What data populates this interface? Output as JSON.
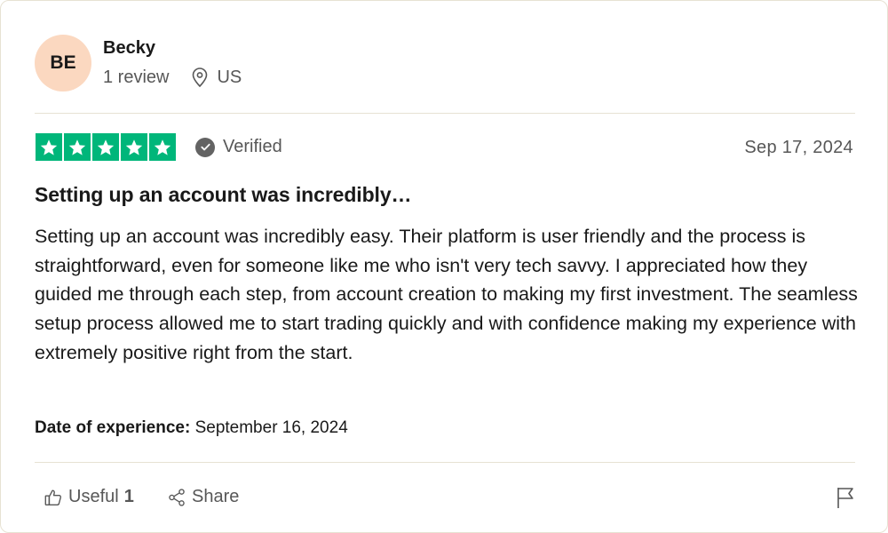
{
  "reviewer": {
    "initials": "BE",
    "name": "Becky",
    "review_count": "1 review",
    "country": "US",
    "avatar_color": "#fbd8c0"
  },
  "rating": {
    "stars": 5,
    "max_stars": 5,
    "star_color": "#00b67a",
    "verified_label": "Verified",
    "date": "Sep 17, 2024"
  },
  "review": {
    "title": "Setting up an account was incredibly…",
    "body": "Setting up an account was incredibly easy. Their platform is user friendly and the process is straightforward, even for someone like me who isn't very tech savvy. I appreciated how they guided me through each step, from account creation to making my first investment. The seamless setup process allowed me to start trading quickly and with confidence making my experience with extremely positive right from the start."
  },
  "experience": {
    "label": "Date of experience:",
    "value": "September 16, 2024"
  },
  "actions": {
    "useful_label": "Useful",
    "useful_count": "1",
    "share_label": "Share",
    "icons": [
      "thumbs-up-icon",
      "share-icon",
      "flag-icon",
      "location-pin-icon",
      "verified-check-icon",
      "star-icon"
    ]
  }
}
